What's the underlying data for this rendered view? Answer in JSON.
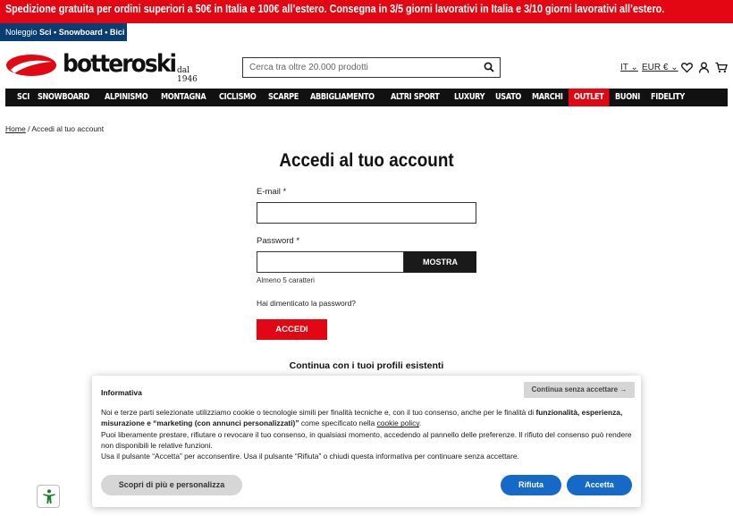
{
  "promo": {
    "text": "Spedizione gratuita per ordini superiori a 50€ in Italia e 100€ all’estero. Consegna in 3/5 giorni lavorativi in Italia e 3/10 giorni lavorativi all’estero."
  },
  "rental": {
    "prefix": "Noleggio",
    "items": "Sci • Snowboard • Bici"
  },
  "logo": {
    "name": "botteroski",
    "sub": "dal 1946"
  },
  "search": {
    "placeholder": "Cerca tra oltre 20.000 prodotti",
    "icon": "search-icon"
  },
  "header": {
    "language": "IT",
    "currency": "EUR €"
  },
  "nav": [
    "SCI",
    "SNOWBOARD",
    "ALPINISMO",
    "MONTAGNA",
    "CICLISMO",
    "SCARPE",
    "ABBIGLIAMENTO",
    "ALTRI SPORT",
    "LUXURY",
    "USATO",
    "MARCHI",
    "OUTLET",
    "BUONI",
    "FIDELITY"
  ],
  "breadcrumb": {
    "home": "Home",
    "separator": "/",
    "current": "Accedi al tuo account"
  },
  "login": {
    "title": "Accedi al tuo account",
    "email_label": "E-mail *",
    "password_label": "Password *",
    "show_button": "MOSTRA",
    "password_hint": "Almeno 5 caratteri",
    "forgot": "Hai dimenticato la password?",
    "submit": "ACCEDI",
    "continue_with": "Continua con i tuoi profili esistenti"
  },
  "cookie": {
    "title": "Informativa",
    "skip": "Continua senza accettare →",
    "line1_a": "Noi e terze parti selezionate utilizziamo cookie o tecnologie simili per finalità tecniche e, con il tuo consenso, anche per le finalità di ",
    "line1_b": "funzionalità, esperienza, misurazione e “marketing (con annunci personalizzati)”",
    "line1_c": " come specificato nella ",
    "policy_link": "cookie policy",
    "line1_d": ".",
    "line2": "Puoi liberamente prestare, rifiutare o revocare il tuo consenso, in qualsiasi momento, accedendo al pannello delle preferenze. Il rifiuto del consenso può rendere non disponibili le relative funzioni.",
    "line3": "Usa il pulsante “Accetta” per acconsentire. Usa il pulsante “Rifiuta” o chiudi questa informativa per continuare senza accettare.",
    "more_button": "Scopri di più e personalizza",
    "reject_button": "Rifiuta",
    "accept_button": "Accetta"
  },
  "colors": {
    "brand_red": "#e30613",
    "navy": "#0b3d73",
    "nav_black": "#111111",
    "cookie_blue": "#1569c7"
  }
}
